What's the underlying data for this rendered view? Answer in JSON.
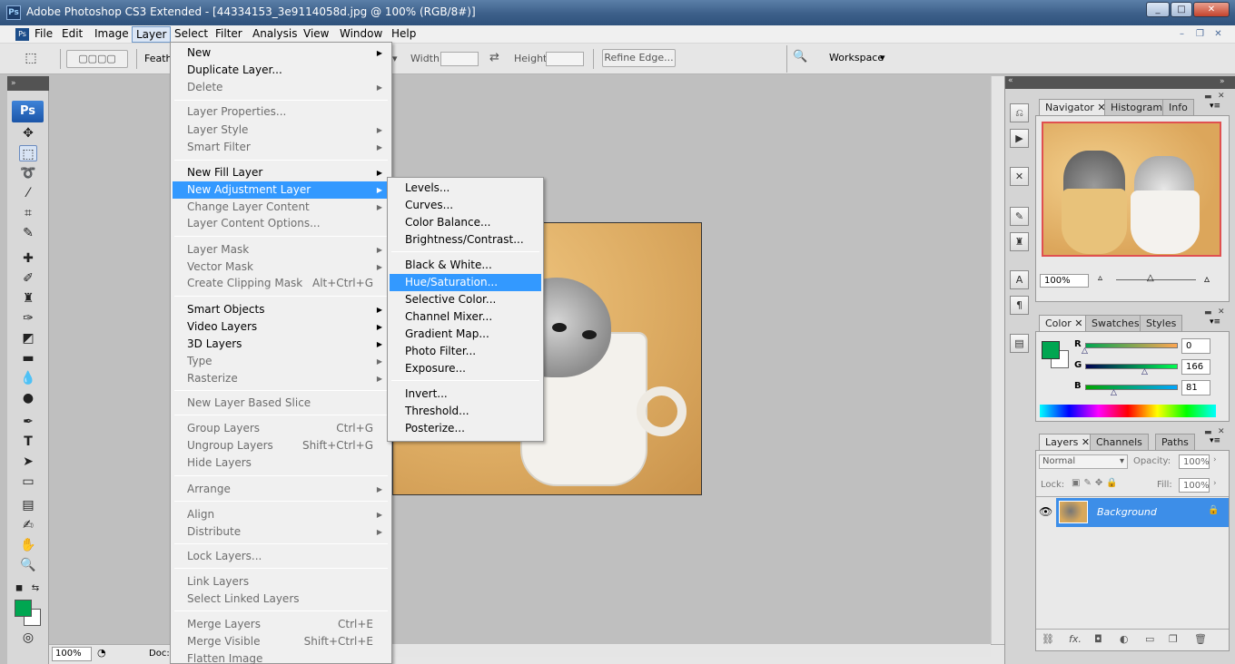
{
  "window": {
    "title": "Adobe Photoshop CS3 Extended - [44334153_3e9114058d.jpg @ 100% (RGB/8#)]",
    "app_logo": "Ps"
  },
  "menubar": {
    "items": [
      "File",
      "Edit",
      "Image",
      "Layer",
      "Select",
      "Filter",
      "Analysis",
      "View",
      "Window",
      "Help"
    ],
    "active": "Layer"
  },
  "options": {
    "feather_label": "Feathe",
    "width_label": "Width:",
    "height_label": "Height:",
    "refine_edge": "Refine Edge...",
    "workspace": "Workspace"
  },
  "toolbox": {
    "badge": "Ps"
  },
  "layer_menu": {
    "items": [
      {
        "label": "New",
        "disabled": false,
        "arrow": true
      },
      {
        "label": "Duplicate Layer...",
        "disabled": false
      },
      {
        "label": "Delete",
        "disabled": true,
        "arrow": true
      },
      {
        "label": "Layer Properties...",
        "disabled": true
      },
      {
        "label": "Layer Style",
        "disabled": true,
        "arrow": true
      },
      {
        "label": "Smart Filter",
        "disabled": true,
        "arrow": true
      },
      {
        "label": "New Fill Layer",
        "disabled": false,
        "arrow": true
      },
      {
        "label": "New Adjustment Layer",
        "disabled": false,
        "arrow": true,
        "highlighted": true
      },
      {
        "label": "Change Layer Content",
        "disabled": true,
        "arrow": true
      },
      {
        "label": "Layer Content Options...",
        "disabled": true
      },
      {
        "label": "Layer Mask",
        "disabled": true,
        "arrow": true
      },
      {
        "label": "Vector Mask",
        "disabled": true,
        "arrow": true
      },
      {
        "label": "Create Clipping Mask",
        "disabled": true,
        "shortcut": "Alt+Ctrl+G"
      },
      {
        "label": "Smart Objects",
        "disabled": false,
        "arrow": true
      },
      {
        "label": "Video Layers",
        "disabled": false,
        "arrow": true
      },
      {
        "label": "3D Layers",
        "disabled": false,
        "arrow": true
      },
      {
        "label": "Type",
        "disabled": true,
        "arrow": true
      },
      {
        "label": "Rasterize",
        "disabled": true,
        "arrow": true
      },
      {
        "label": "New Layer Based Slice",
        "disabled": true
      },
      {
        "label": "Group Layers",
        "disabled": true,
        "shortcut": "Ctrl+G"
      },
      {
        "label": "Ungroup Layers",
        "disabled": true,
        "shortcut": "Shift+Ctrl+G"
      },
      {
        "label": "Hide Layers",
        "disabled": true
      },
      {
        "label": "Arrange",
        "disabled": true,
        "arrow": true
      },
      {
        "label": "Align",
        "disabled": true,
        "arrow": true
      },
      {
        "label": "Distribute",
        "disabled": true,
        "arrow": true
      },
      {
        "label": "Lock Layers...",
        "disabled": true
      },
      {
        "label": "Link Layers",
        "disabled": true
      },
      {
        "label": "Select Linked Layers",
        "disabled": true
      },
      {
        "label": "Merge Layers",
        "disabled": true,
        "shortcut": "Ctrl+E"
      },
      {
        "label": "Merge Visible",
        "disabled": true,
        "shortcut": "Shift+Ctrl+E"
      },
      {
        "label": "Flatten Image",
        "disabled": true
      }
    ]
  },
  "adjustment_submenu": {
    "items": [
      "Levels...",
      "Curves...",
      "Color Balance...",
      "Brightness/Contrast...",
      "Black & White...",
      "Hue/Saturation...",
      "Selective Color...",
      "Channel Mixer...",
      "Gradient Map...",
      "Photo Filter...",
      "Exposure...",
      "Invert...",
      "Threshold...",
      "Posterize..."
    ],
    "highlighted": "Hue/Saturation..."
  },
  "navigator": {
    "tabs": [
      "Navigator",
      "Histogram",
      "Info"
    ],
    "zoom": "100%"
  },
  "color_panel": {
    "tabs": [
      "Color",
      "Swatches",
      "Styles"
    ],
    "r_label": "R",
    "g_label": "G",
    "b_label": "B",
    "r": "0",
    "g": "166",
    "b": "81",
    "foreground": "#00a651"
  },
  "layers_panel": {
    "tabs": [
      "Layers",
      "Channels",
      "Paths"
    ],
    "blend_mode": "Normal",
    "opacity_label": "Opacity:",
    "opacity": "100%",
    "lock_label": "Lock:",
    "fill_label": "Fill:",
    "fill": "100%",
    "layer_name": "Background"
  },
  "status": {
    "zoom": "100%",
    "doc_label": "Doc:"
  }
}
